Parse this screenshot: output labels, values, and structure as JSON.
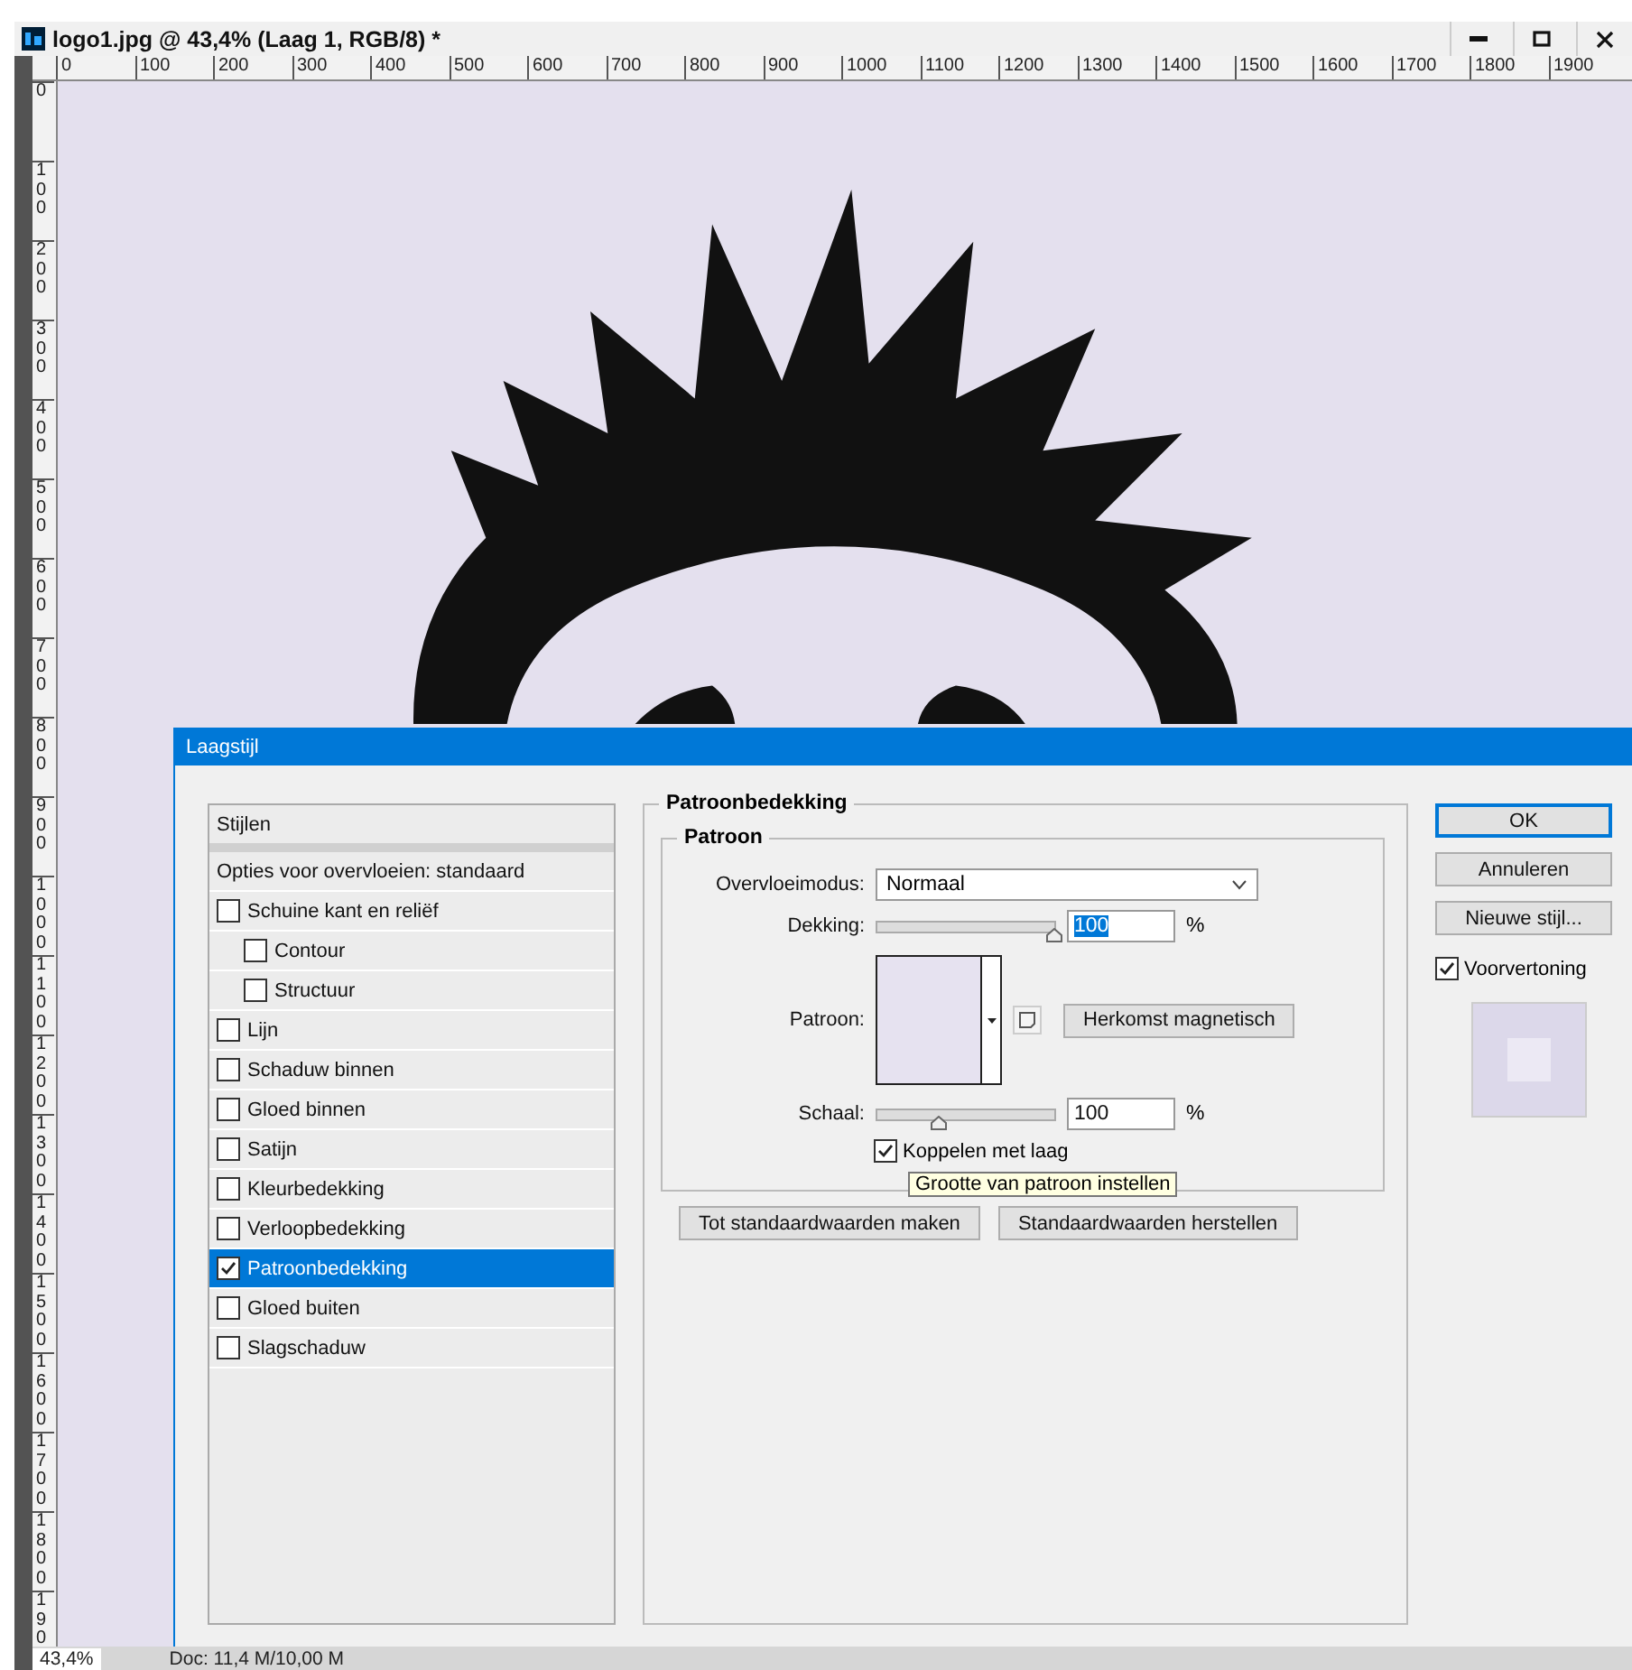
{
  "document": {
    "title": "logo1.jpg @ 43,4% (Laag 1, RGB/8) *",
    "ruler_h": [
      "0",
      "100",
      "200",
      "300",
      "400",
      "500",
      "600",
      "700",
      "800",
      "900",
      "1000",
      "1100",
      "1200",
      "1300",
      "1400",
      "1500",
      "1600",
      "1700",
      "1800",
      "1900"
    ],
    "ruler_v": [
      "0",
      "100",
      "200",
      "300",
      "400",
      "500",
      "600",
      "700",
      "800",
      "900",
      "1000",
      "1100",
      "1200",
      "1300",
      "1400",
      "1500",
      "1600",
      "1700",
      "1800",
      "190"
    ],
    "status": {
      "zoom": "43,4%",
      "doc": "Doc: 11,4 M/10,00 M"
    }
  },
  "dialog": {
    "title": "Laagstijl",
    "styles": [
      {
        "kind": "header",
        "label": "Stijlen"
      },
      {
        "kind": "blending",
        "label": "Opties voor overvloeien: standaard",
        "selected": false
      },
      {
        "kind": "effect",
        "label": "Schuine kant en reliëf",
        "checked": false,
        "selected": false,
        "children": [
          {
            "kind": "effect",
            "label": "Contour",
            "checked": false,
            "selected": false
          },
          {
            "kind": "effect",
            "label": "Structuur",
            "checked": false,
            "selected": false
          }
        ]
      },
      {
        "kind": "effect",
        "label": "Lijn",
        "checked": false,
        "selected": false
      },
      {
        "kind": "effect",
        "label": "Schaduw binnen",
        "checked": false,
        "selected": false
      },
      {
        "kind": "effect",
        "label": "Gloed binnen",
        "checked": false,
        "selected": false
      },
      {
        "kind": "effect",
        "label": "Satijn",
        "checked": false,
        "selected": false
      },
      {
        "kind": "effect",
        "label": "Kleurbedekking",
        "checked": false,
        "selected": false
      },
      {
        "kind": "effect",
        "label": "Verloopbedekking",
        "checked": false,
        "selected": false
      },
      {
        "kind": "effect",
        "label": "Patroonbedekking",
        "checked": true,
        "selected": true
      },
      {
        "kind": "effect",
        "label": "Gloed buiten",
        "checked": false,
        "selected": false
      },
      {
        "kind": "effect",
        "label": "Slagschaduw",
        "checked": false,
        "selected": false
      }
    ],
    "section_title": "Patroonbedekking",
    "group_title": "Patroon",
    "blend_mode": {
      "label": "Overvloeimodus:",
      "value": "Normaal"
    },
    "opacity": {
      "label": "Dekking:",
      "level": 1,
      "value": "100",
      "value_highlighted": true,
      "unit": "%"
    },
    "pattern": {
      "label": "Patroon:",
      "button": "Herkomst magnetisch"
    },
    "scale": {
      "label": "Schaal:",
      "level": 0.35,
      "value": "100",
      "value_highlighted": false,
      "unit": "%"
    },
    "link": {
      "label": "Koppelen met laag",
      "checked": true
    },
    "tooltip": "Grootte van patroon instellen",
    "bottom_buttons": [
      "Tot standaardwaarden maken",
      "Standaardwaarden herstellen"
    ],
    "side_buttons": [
      {
        "label": "OK",
        "default": true
      },
      {
        "label": "Annuleren",
        "default": false
      },
      {
        "label": "Nieuwe stijl...",
        "default": false
      }
    ],
    "preview": {
      "label": "Voorvertoning",
      "checked": true
    }
  }
}
